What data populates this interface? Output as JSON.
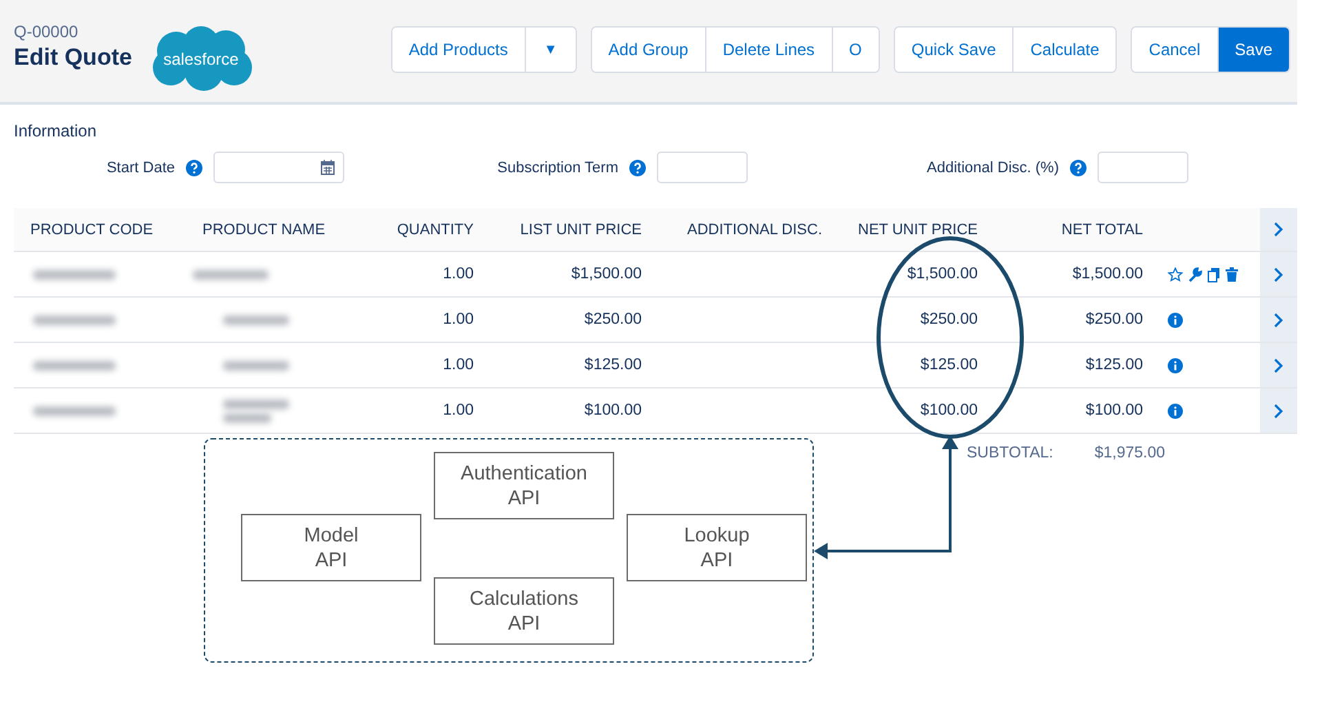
{
  "header": {
    "record_number": "Q-00000",
    "title": "Edit Quote",
    "logo": "salesforce"
  },
  "button_groups": [
    [
      {
        "label": "Add Products",
        "kind": "text"
      },
      {
        "label": "▼",
        "kind": "caret"
      }
    ],
    [
      {
        "label": "Add Group",
        "kind": "text"
      },
      {
        "label": "Delete Lines",
        "kind": "text"
      },
      {
        "label": "O",
        "kind": "text"
      }
    ],
    [
      {
        "label": "Quick Save",
        "kind": "text"
      },
      {
        "label": "Calculate",
        "kind": "text"
      }
    ],
    [
      {
        "label": "Cancel",
        "kind": "text"
      },
      {
        "label": "Save",
        "kind": "primary"
      }
    ]
  ],
  "section_title": "Information",
  "fields": [
    {
      "label": "Start Date",
      "kind": "date"
    },
    {
      "label": "Subscription Term",
      "kind": "text"
    },
    {
      "label": "Additional Disc. (%)",
      "kind": "text"
    }
  ],
  "table": {
    "columns": [
      "PRODUCT CODE",
      "PRODUCT NAME",
      "QUANTITY",
      "LIST UNIT PRICE",
      "ADDITIONAL DISC.",
      "NET UNIT PRICE",
      "NET TOTAL"
    ],
    "rows": [
      {
        "quantity": "1.00",
        "list_unit_price": "$1,500.00",
        "net_unit_price": "$1,500.00",
        "net_total": "$1,500.00",
        "kind": "tools"
      },
      {
        "quantity": "1.00",
        "list_unit_price": "$250.00",
        "net_unit_price": "$250.00",
        "net_total": "$250.00",
        "kind": "info"
      },
      {
        "quantity": "1.00",
        "list_unit_price": "$125.00",
        "net_unit_price": "$125.00",
        "net_total": "$125.00",
        "kind": "info"
      },
      {
        "quantity": "1.00",
        "list_unit_price": "$100.00",
        "net_unit_price": "$100.00",
        "net_total": "$100.00",
        "kind": "info"
      }
    ],
    "subtotal_label": "SUBTOTAL:",
    "subtotal_value": "$1,975.00"
  },
  "diagram": {
    "boxes": [
      "Model\nAPI",
      "Authentication\nAPI",
      "Lookup\nAPI",
      "Calculations\nAPI"
    ]
  }
}
